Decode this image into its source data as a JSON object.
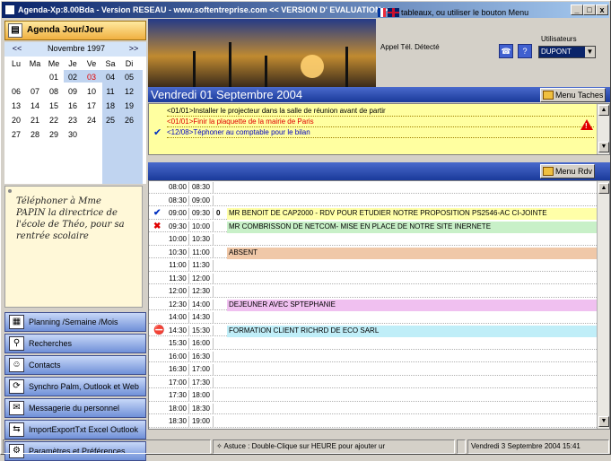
{
  "window": {
    "title": "Agenda-Xp:8.00Bda - Version RESEAU - www.softentreprise.com << VERSION D' EVALUATION >>",
    "min": "_",
    "max": "□",
    "close": "x"
  },
  "left": {
    "agenda_button": "Agenda Jour/Jour",
    "calendar": {
      "prev": "<<",
      "next": ">>",
      "month": "Novembre 1997",
      "weekdays": [
        "Lu",
        "Ma",
        "Me",
        "Je",
        "Ve",
        "Sa",
        "Di"
      ],
      "weeks": [
        [
          "",
          "",
          "01",
          "02",
          "03",
          "04",
          "05"
        ],
        [
          "06",
          "07",
          "08",
          "09",
          "10",
          "11",
          "12"
        ],
        [
          "13",
          "14",
          "15",
          "16",
          "17",
          "18",
          "19"
        ],
        [
          "20",
          "21",
          "22",
          "23",
          "24",
          "25",
          "26"
        ],
        [
          "27",
          "28",
          "29",
          "30",
          "",
          "",
          ""
        ]
      ],
      "highlight_color": "#c0d4f0",
      "red_day": "03"
    },
    "note": "Téléphoner à Mme PAPIN la directrice de l'école de Théo, pour sa rentrée scolaire",
    "nav": [
      {
        "label": "Planning /Semaine /Mois",
        "icon": "calendar-icon"
      },
      {
        "label": "Recherches",
        "icon": "search-icon"
      },
      {
        "label": "Contacts",
        "icon": "contacts-icon"
      },
      {
        "label": "Synchro Palm, Outlook et Web",
        "icon": "sync-icon"
      },
      {
        "label": "Messagerie du personnel",
        "icon": "mail-icon"
      },
      {
        "label": "ImportExportTxt Excel Outlook",
        "icon": "import-export-icon"
      },
      {
        "label": "Paramètres et Préférences",
        "icon": "settings-icon"
      }
    ]
  },
  "header": {
    "tip": "tableaux, ou utiliser le bouton Menu",
    "call_detected": "Appel Tél. Détecté",
    "users_label": "Utilisateurs",
    "user": "DUPONT",
    "dropdown": "▼"
  },
  "day": {
    "title": "Vendredi 01 Septembre 2004",
    "menu_taches": "Menu Taches",
    "menu_rdv": "Menu Rdv"
  },
  "tasks": [
    {
      "text": "<01/01>Installer le projecteur dans la salle de réunion avant de partir",
      "color": "#000000",
      "check": ""
    },
    {
      "text": "<01/01>Finir la plaquette de la mairie de Paris",
      "color": "#e00000",
      "check": ""
    },
    {
      "text": "<12/08>Téphoner au comptable pour le bilan",
      "color": "#0000c0",
      "check": "✔"
    }
  ],
  "warning": "!",
  "agenda": [
    {
      "start": "08:00",
      "end": "08:30",
      "text": "",
      "bg": "",
      "mark": ""
    },
    {
      "start": "08:30",
      "end": "09:00",
      "text": "",
      "bg": "",
      "mark": ""
    },
    {
      "start": "09:00",
      "end": "09:30",
      "text": "MR BENOIT DE CAP2000 - RDV POUR ETUDIER NOTRE PROPOSITION PS2546-AC CI-JOINTE",
      "bg": "#ffffa8",
      "mark": "✔",
      "clip": "0"
    },
    {
      "start": "09:30",
      "end": "10:00",
      "text": "MR COMBRISSON DE NETCOM- MISE EN PLACE DE NOTRE SITE INERNETE",
      "bg": "#c8f0c8",
      "mark": "✖"
    },
    {
      "start": "10:00",
      "end": "10:30",
      "text": "",
      "bg": "",
      "mark": ""
    },
    {
      "start": "10:30",
      "end": "11:00",
      "text": "ABSENT",
      "bg": "#f0c8a8",
      "mark": ""
    },
    {
      "start": "11:00",
      "end": "11:30",
      "text": "",
      "bg": "",
      "mark": ""
    },
    {
      "start": "11:30",
      "end": "12:00",
      "text": "",
      "bg": "",
      "mark": ""
    },
    {
      "start": "12:00",
      "end": "12:30",
      "text": "",
      "bg": "",
      "mark": ""
    },
    {
      "start": "12:30",
      "end": "14:00",
      "text": "DEJEUNER AVEC SPTEPHANIE",
      "bg": "#f0c0f0",
      "mark": ""
    },
    {
      "start": "14:00",
      "end": "14:30",
      "text": "",
      "bg": "",
      "mark": ""
    },
    {
      "start": "14:30",
      "end": "15:30",
      "text": "FORMATION CLIENT RICHRD DE ECO SARL",
      "bg": "#c0eef8",
      "mark": "⛔"
    },
    {
      "start": "15:30",
      "end": "16:00",
      "text": "",
      "bg": "",
      "mark": ""
    },
    {
      "start": "16:00",
      "end": "16:30",
      "text": "",
      "bg": "",
      "mark": ""
    },
    {
      "start": "16:30",
      "end": "17:00",
      "text": "",
      "bg": "",
      "mark": ""
    },
    {
      "start": "17:00",
      "end": "17:30",
      "text": "",
      "bg": "",
      "mark": ""
    },
    {
      "start": "17:30",
      "end": "18:00",
      "text": "",
      "bg": "",
      "mark": ""
    },
    {
      "start": "18:00",
      "end": "18:30",
      "text": "",
      "bg": "",
      "mark": ""
    },
    {
      "start": "18:30",
      "end": "19:00",
      "text": "",
      "bg": "",
      "mark": ""
    }
  ],
  "status": {
    "tip": "Astuce : Double-Clique sur HEURE pour ajouter ur",
    "date": "Vendredi 3 Septembre 2004 15:41"
  }
}
